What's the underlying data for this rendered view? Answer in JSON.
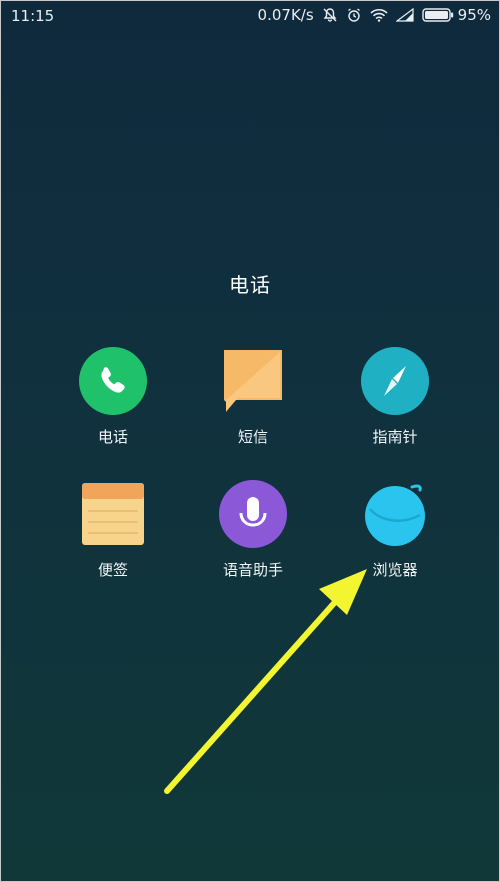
{
  "status_bar": {
    "time": "11:15",
    "net_speed": "0.07K/s",
    "battery": "95%"
  },
  "folder": {
    "title": "电话"
  },
  "apps": [
    {
      "label": "电话",
      "icon": "phone-icon",
      "color": "#1fc26b"
    },
    {
      "label": "短信",
      "icon": "message-icon",
      "color": "#f6b967"
    },
    {
      "label": "指南针",
      "icon": "compass-icon",
      "color": "#1fb0c3"
    },
    {
      "label": "便签",
      "icon": "notes-icon",
      "color": "#f7d48c"
    },
    {
      "label": "语音助手",
      "icon": "microphone-icon",
      "color": "#8b59d8"
    },
    {
      "label": "浏览器",
      "icon": "browser-icon",
      "color": "#2ac5ee"
    }
  ],
  "annotation": {
    "arrow_color": "#f2f52f"
  }
}
